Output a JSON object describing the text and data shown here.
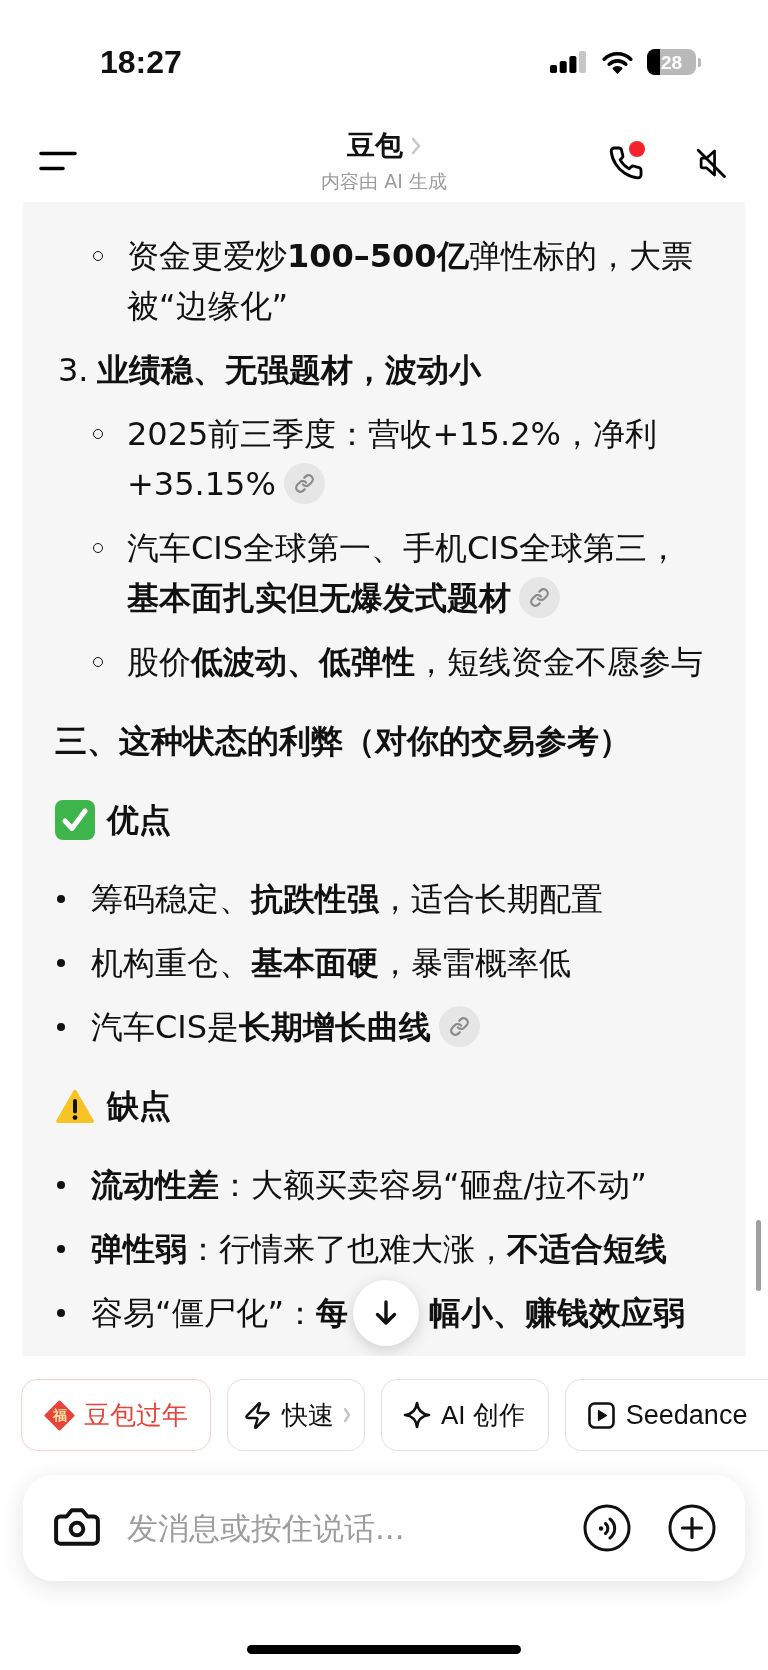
{
  "status_bar": {
    "time": "18:27",
    "battery": "28"
  },
  "header": {
    "title": "豆包",
    "subtitle": "内容由 AI 生成",
    "call_notification": true
  },
  "message": {
    "blocks": [
      {
        "kind": "subitem",
        "text": "资金更爱炒**100–500亿**弹性标的，大票被“边缘化”",
        "citation": false
      },
      {
        "kind": "numbered",
        "number": "3.",
        "text": "业绩稳、无强题材，波动小"
      },
      {
        "kind": "subitem",
        "text": "2025前三季度：营收+15.2%，净利+35.15%",
        "citation": true
      },
      {
        "kind": "subitem",
        "text": "汽车CIS全球第一、手机CIS全球第三，**基本面扎实但无爆发式题材**",
        "citation": true
      },
      {
        "kind": "subitem",
        "text": "股价**低波动、低弹性**，短线资金不愿参与",
        "citation": false
      },
      {
        "kind": "heading",
        "text": "三、这种状态的利弊（对你的交易参考）"
      },
      {
        "kind": "pros",
        "text": "优点"
      },
      {
        "kind": "bullet",
        "text": "筹码稳定、**抗跌性强**，适合长期配置",
        "citation": false
      },
      {
        "kind": "bullet",
        "text": "机构重仓、**基本面硬**，暴雷概率低",
        "citation": false
      },
      {
        "kind": "bullet",
        "text": "汽车CIS是**长期增长曲线**",
        "citation": true
      },
      {
        "kind": "cons",
        "text": "缺点"
      },
      {
        "kind": "bullet",
        "text": "**流动性差**：大额买卖容易“砸盘/拉不动”",
        "citation": false
      },
      {
        "kind": "bullet",
        "text": "**弹性弱**：行情来了也难大涨，**不适合短线**",
        "citation": false
      },
      {
        "kind": "bullet",
        "text": "容易“僵尸化”：**每**",
        "text_continued": "**幅小、赚钱效应弱**",
        "citation": false
      }
    ]
  },
  "quick_actions": [
    {
      "kind": "festive",
      "badge": "福",
      "label": "豆包过年"
    },
    {
      "kind": "fast",
      "label": "快速",
      "dropdown": true
    },
    {
      "kind": "create",
      "label": "AI 创作"
    },
    {
      "kind": "video",
      "label": "Seedance"
    }
  ],
  "composer": {
    "placeholder": "发消息或按住说话..."
  }
}
